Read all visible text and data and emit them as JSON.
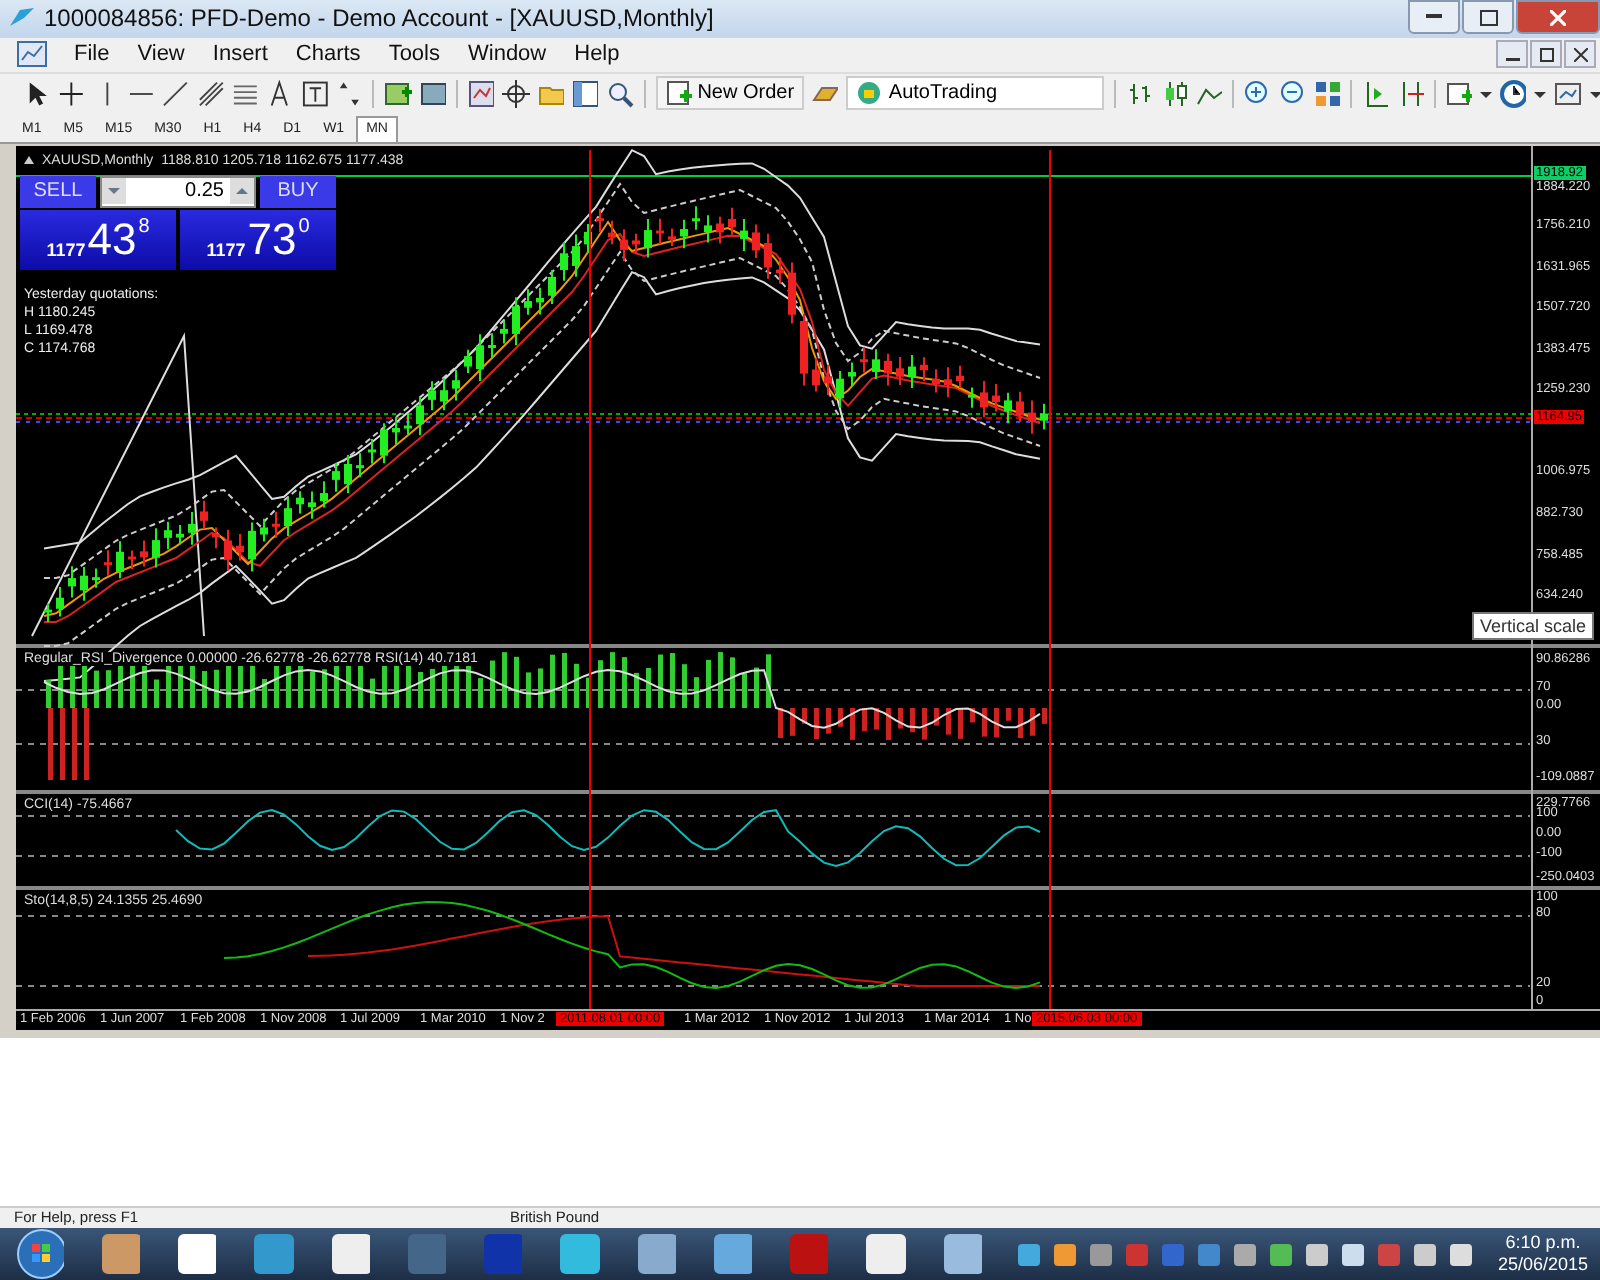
{
  "window": {
    "title": "1000084856: PFD-Demo - Demo Account - [XAUUSD,Monthly]"
  },
  "menu": [
    "File",
    "View",
    "Insert",
    "Charts",
    "Tools",
    "Window",
    "Help"
  ],
  "toolbar": {
    "new_order": "New Order",
    "autotrading": "AutoTrading"
  },
  "timeframes": [
    {
      "label": "M1",
      "selected": false
    },
    {
      "label": "M5",
      "selected": false
    },
    {
      "label": "M15",
      "selected": false
    },
    {
      "label": "M30",
      "selected": false
    },
    {
      "label": "H1",
      "selected": false
    },
    {
      "label": "H4",
      "selected": false
    },
    {
      "label": "D1",
      "selected": false
    },
    {
      "label": "W1",
      "selected": false
    },
    {
      "label": "MN",
      "selected": true
    }
  ],
  "chart": {
    "symbol": "XAUUSD,Monthly",
    "ohlc": "1188.810 1205.718 1162.675 1177.438",
    "price_scale": [
      "1884.220",
      "1756.210",
      "1631.965",
      "1507.720",
      "1383.475",
      "1259.230",
      "1006.975",
      "882.730",
      "758.485",
      "634.240"
    ],
    "high_label": "1918.92",
    "bid_label": "1164.95",
    "tooltip": "Vertical scale"
  },
  "trade_panel": {
    "sell": "SELL",
    "buy": "BUY",
    "lot": "0.25",
    "bid": {
      "big": "1177",
      "pips": "43",
      "point": "8"
    },
    "ask": {
      "big": "1177",
      "pips": "73",
      "point": "0"
    }
  },
  "yesterday": {
    "title": "Yesterday quotations:",
    "lines": [
      "H 1180.245",
      "L 1169.478",
      "C 1174.768"
    ]
  },
  "indicators": [
    {
      "kind": "rsi",
      "header": "Regular_RSI_Divergence 0.00000 -26.62778 -26.62778  RSI(14) 40.7181",
      "scale": [
        "90.86286",
        "70",
        "0.00",
        "30",
        "-109.0887"
      ]
    },
    {
      "kind": "cci",
      "header": "CCI(14) -75.4667",
      "scale": [
        "229.7766",
        "100",
        "0.00",
        "-100",
        "-250.0403"
      ]
    },
    {
      "kind": "stoch",
      "header": "Sto(14,8,5) 24.1355 25.4690",
      "scale": [
        "100",
        "80",
        "20",
        "0"
      ]
    }
  ],
  "time_axis": {
    "labels": [
      "1 Feb 2006",
      "1 Jun 2007",
      "1 Feb 2008",
      "1 Nov 2008",
      "1 Jul 2009",
      "1 Mar 2010",
      "1 Nov 2",
      "1 Mar 2012",
      "1 Nov 2012",
      "1 Jul 2013",
      "1 Mar 2014",
      "1 No"
    ],
    "markers": [
      "2011.08.01 00:00",
      "2015.06.03 00:00"
    ]
  },
  "status_bar": [
    "For Help, press F1",
    "British Pound"
  ],
  "taskbar": {
    "time": "6:10 p.m.",
    "date": "25/06/2015"
  }
}
